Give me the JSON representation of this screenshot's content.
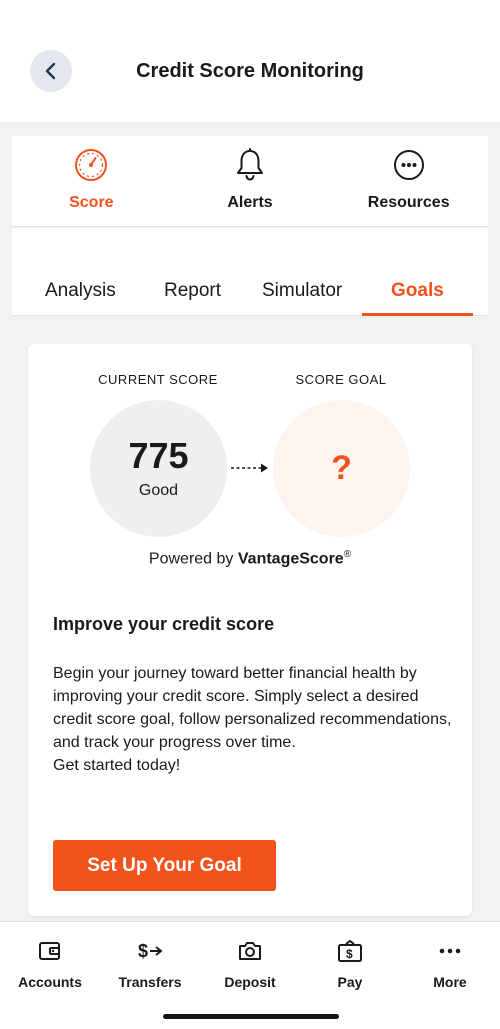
{
  "header": {
    "title": "Credit Score Monitoring",
    "back_icon": "chevron-left-icon"
  },
  "top_tabs": [
    {
      "label": "Score",
      "icon": "speedometer-icon",
      "active": true
    },
    {
      "label": "Alerts",
      "icon": "bell-icon",
      "active": false
    },
    {
      "label": "Resources",
      "icon": "more-circle-icon",
      "active": false
    }
  ],
  "sub_tabs": [
    {
      "label": "Analysis",
      "active": false
    },
    {
      "label": "Report",
      "active": false
    },
    {
      "label": "Simulator",
      "active": false
    },
    {
      "label": "Goals",
      "active": true
    }
  ],
  "score_card": {
    "current_label": "CURRENT SCORE",
    "current_value": "775",
    "current_rating": "Good",
    "goal_label": "SCORE GOAL",
    "goal_value": "?",
    "powered_prefix": "Powered by",
    "powered_brand": "VantageScore",
    "powered_mark": "®",
    "improve_title": "Improve your credit score",
    "improve_body": "Begin your journey toward better financial health by improving your credit score. Simply select a desired credit score goal, follow personalized recommendations, and track your progress over time.",
    "improve_cta_text": "Get started today!",
    "button_label": "Set Up Your Goal"
  },
  "bottom_nav": [
    {
      "label": "Accounts",
      "icon": "wallet-icon"
    },
    {
      "label": "Transfers",
      "icon": "transfer-dollar-icon"
    },
    {
      "label": "Deposit",
      "icon": "camera-icon"
    },
    {
      "label": "Pay",
      "icon": "bill-pay-icon"
    },
    {
      "label": "More",
      "icon": "more-dots-icon"
    }
  ],
  "colors": {
    "accent": "#f2521b",
    "background": "#f2f2f2",
    "text": "#1a1a1a"
  }
}
